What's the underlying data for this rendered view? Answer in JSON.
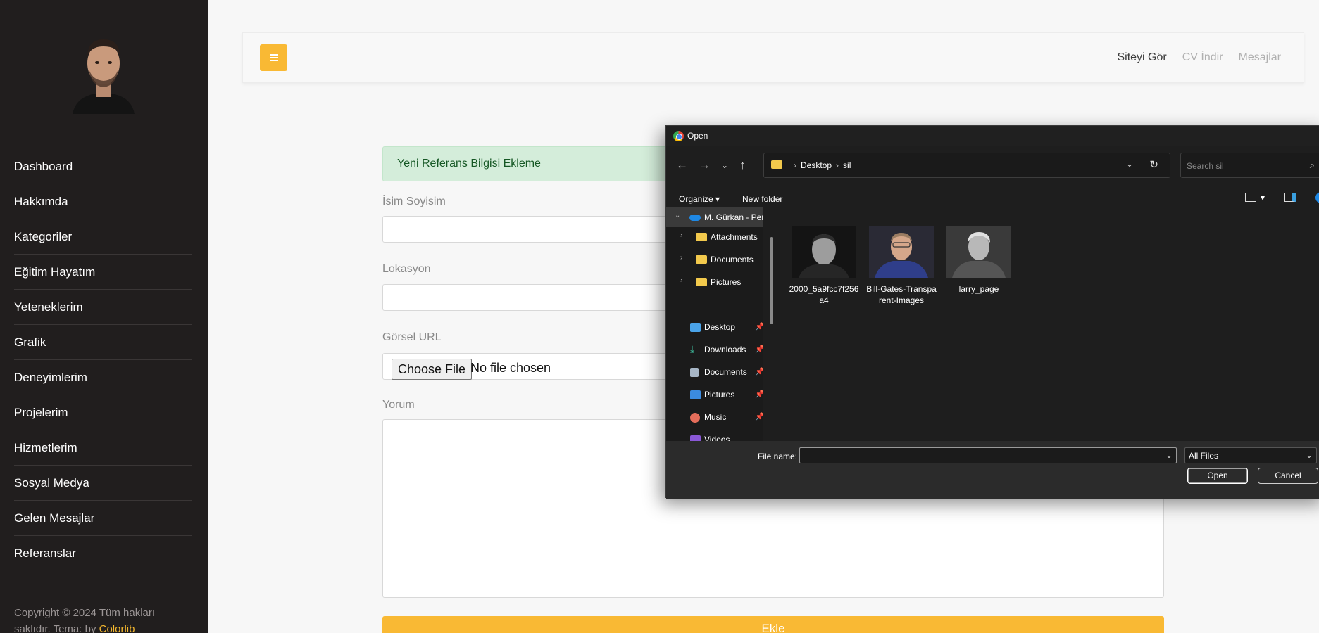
{
  "sidebar": {
    "nav": [
      "Dashboard",
      "Hakkımda",
      "Kategoriler",
      "Eğitim Hayatım",
      "Yeteneklerim",
      "Grafik",
      "Deneyimlerim",
      "Projelerim",
      "Hizmetlerim",
      "Sosyal Medya",
      "Gelen Mesajlar",
      "Referanslar"
    ],
    "copyright": "Copyright © 2024 Tüm hakları saklıdır. Tema: by",
    "copyright_link": "Colorlib"
  },
  "header": {
    "links": [
      "Siteyi Gör",
      "CV İndir",
      "Mesajlar"
    ]
  },
  "form": {
    "alert": "Yeni Referans Bilgisi Ekleme",
    "name_label": "İsim Soyisim",
    "location_label": "Lokasyon",
    "image_label": "Görsel URL",
    "file_button": "Choose File",
    "file_status": "No file chosen",
    "comment_label": "Yorum",
    "submit": "Ekle"
  },
  "dialog": {
    "title": "Open",
    "path": [
      "Desktop",
      "sil"
    ],
    "search_placeholder": "Search sil",
    "organize": "Organize",
    "new_folder": "New folder",
    "tree": {
      "onedrive": "M. Gürkan - Per",
      "folders": [
        "Attachments",
        "Documents",
        "Pictures"
      ],
      "quick": [
        "Desktop",
        "Downloads",
        "Documents",
        "Pictures",
        "Music",
        "Videos"
      ]
    },
    "files": [
      "2000_5a9fcc7f256a4",
      "Bill-Gates-Transparent-Images",
      "larry_page"
    ],
    "file_name_label": "File name:",
    "filter": "All Files",
    "open_button": "Open",
    "cancel_button": "Cancel"
  }
}
